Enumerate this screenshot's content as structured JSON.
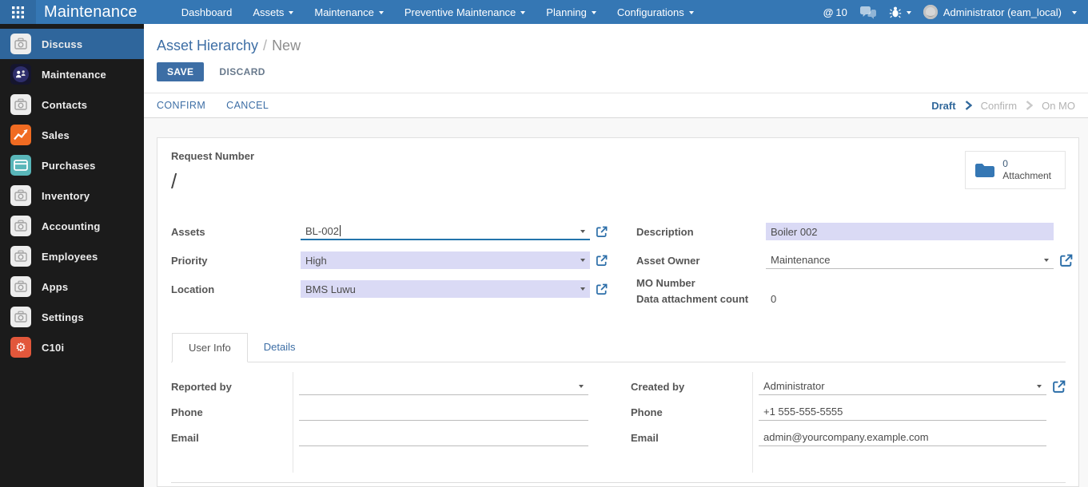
{
  "colors": {
    "topbar": "#3577b4",
    "topbar_square": "#306ba3",
    "accent": "#3d6ea5",
    "sidebar_bg": "#1b1b1b",
    "sidebar_active": "#2f669c",
    "field_highlight": "#dadaf5",
    "focused_underline": "#2374ab",
    "status_active": "#31689b"
  },
  "topbar": {
    "brand": "Maintenance",
    "menus": [
      {
        "label": "Dashboard"
      },
      {
        "label": "Assets"
      },
      {
        "label": "Maintenance"
      },
      {
        "label": "Preventive Maintenance"
      },
      {
        "label": "Planning"
      },
      {
        "label": "Configurations"
      }
    ],
    "mention": {
      "symbol": "@",
      "count": "10"
    },
    "user_name": "Administrator (eam_local)"
  },
  "sidebar": {
    "items": [
      {
        "label": "Discuss"
      },
      {
        "label": "Maintenance"
      },
      {
        "label": "Contacts"
      },
      {
        "label": "Sales"
      },
      {
        "label": "Purchases"
      },
      {
        "label": "Inventory"
      },
      {
        "label": "Accounting"
      },
      {
        "label": "Employees"
      },
      {
        "label": "Apps"
      },
      {
        "label": "Settings"
      },
      {
        "label": "C10i"
      }
    ]
  },
  "breadcrumb": {
    "parent": "Asset Hierarchy",
    "separator": "/",
    "current": "New"
  },
  "actions": {
    "save": "SAVE",
    "discard": "DISCARD",
    "confirm": "CONFIRM",
    "cancel": "CANCEL"
  },
  "statusbar": {
    "stages": [
      {
        "label": "Draft"
      },
      {
        "label": "Confirm"
      },
      {
        "label": "On MO"
      }
    ]
  },
  "sheet": {
    "request_number": {
      "label": "Request Number",
      "value": "/"
    },
    "attachment": {
      "count": "0",
      "label": "Attachment"
    },
    "fields": {
      "assets": {
        "label": "Assets",
        "value": "BL-002"
      },
      "priority": {
        "label": "Priority",
        "value": "High"
      },
      "location": {
        "label": "Location",
        "value": "BMS Luwu"
      },
      "description": {
        "label": "Description",
        "value": "Boiler 002"
      },
      "asset_owner": {
        "label": "Asset Owner",
        "value": "Maintenance"
      },
      "mo_number": {
        "label": "MO Number",
        "value": ""
      },
      "data_attachment_count": {
        "label": "Data attachment count",
        "value": "0"
      }
    },
    "tabs": [
      {
        "label": "User Info"
      },
      {
        "label": "Details"
      }
    ],
    "user_info": {
      "reported_by": {
        "label": "Reported by",
        "value": ""
      },
      "phone": {
        "label": "Phone",
        "value": ""
      },
      "email": {
        "label": "Email",
        "value": ""
      },
      "created_by": {
        "label": "Created by",
        "value": "Administrator"
      },
      "phone_right": {
        "label": "Phone",
        "value": "+1 555-555-5555"
      },
      "email_right": {
        "label": "Email",
        "value": "admin@yourcompany.example.com"
      }
    }
  }
}
